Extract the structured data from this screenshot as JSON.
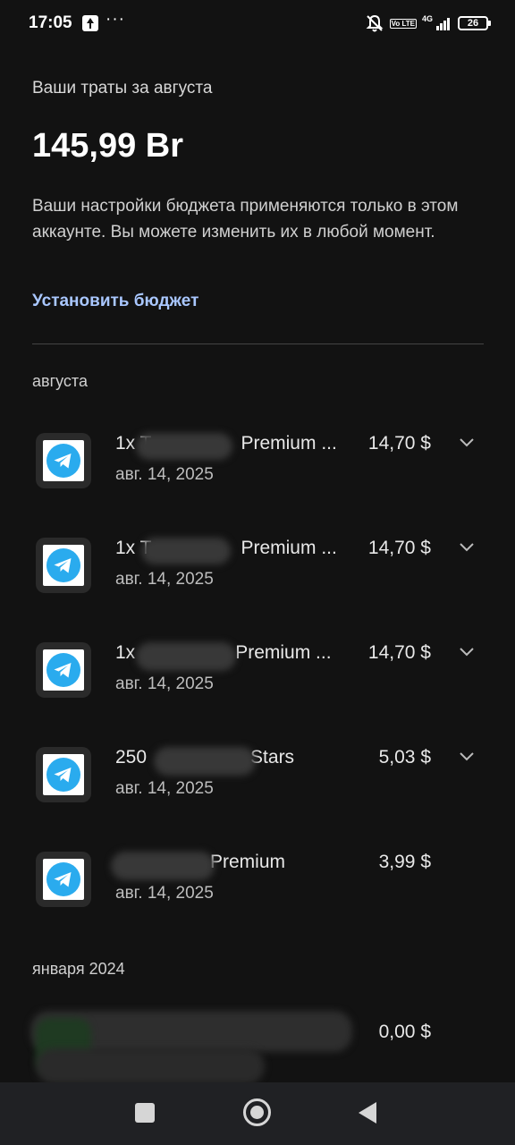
{
  "status_bar": {
    "time": "17:05",
    "more": "···",
    "network": "4G",
    "volte": "Vo LTE",
    "battery": "26"
  },
  "summary": {
    "label": "Ваши траты за августа",
    "amount": "145,99 Br",
    "description": "Ваши настройки бюджета применяются только в этом аккаунте. Вы можете изменить их в любой момент.",
    "set_budget": "Установить бюджет"
  },
  "sections": [
    {
      "label": "августа",
      "transactions": [
        {
          "title_prefix": "1x T",
          "title_suffix": "Premium ...",
          "date": "авг. 14, 2025",
          "price": "14,70 $",
          "icon": "telegram-icon",
          "expandable": true
        },
        {
          "title_prefix": "1x T",
          "title_suffix": "Premium ...",
          "date": "авг. 14, 2025",
          "price": "14,70 $",
          "icon": "telegram-icon",
          "expandable": true
        },
        {
          "title_prefix": "1x",
          "title_suffix": "Premium ...",
          "date": "авг. 14, 2025",
          "price": "14,70 $",
          "icon": "telegram-icon",
          "expandable": true
        },
        {
          "title_prefix": "250",
          "title_suffix": "Stars",
          "date": "авг. 14, 2025",
          "price": "5,03 $",
          "icon": "telegram-icon",
          "expandable": true
        },
        {
          "title_prefix": "",
          "title_suffix": "Premium",
          "date": "авг. 14, 2025",
          "price": "3,99 $",
          "icon": "telegram-icon",
          "expandable": false
        }
      ]
    },
    {
      "label": "января 2024",
      "transactions": [
        {
          "price": "0,00 $"
        }
      ]
    }
  ],
  "colors": {
    "background": "#121212",
    "accent_link": "#a9c7ff",
    "telegram_blue": "#2AABEE"
  }
}
